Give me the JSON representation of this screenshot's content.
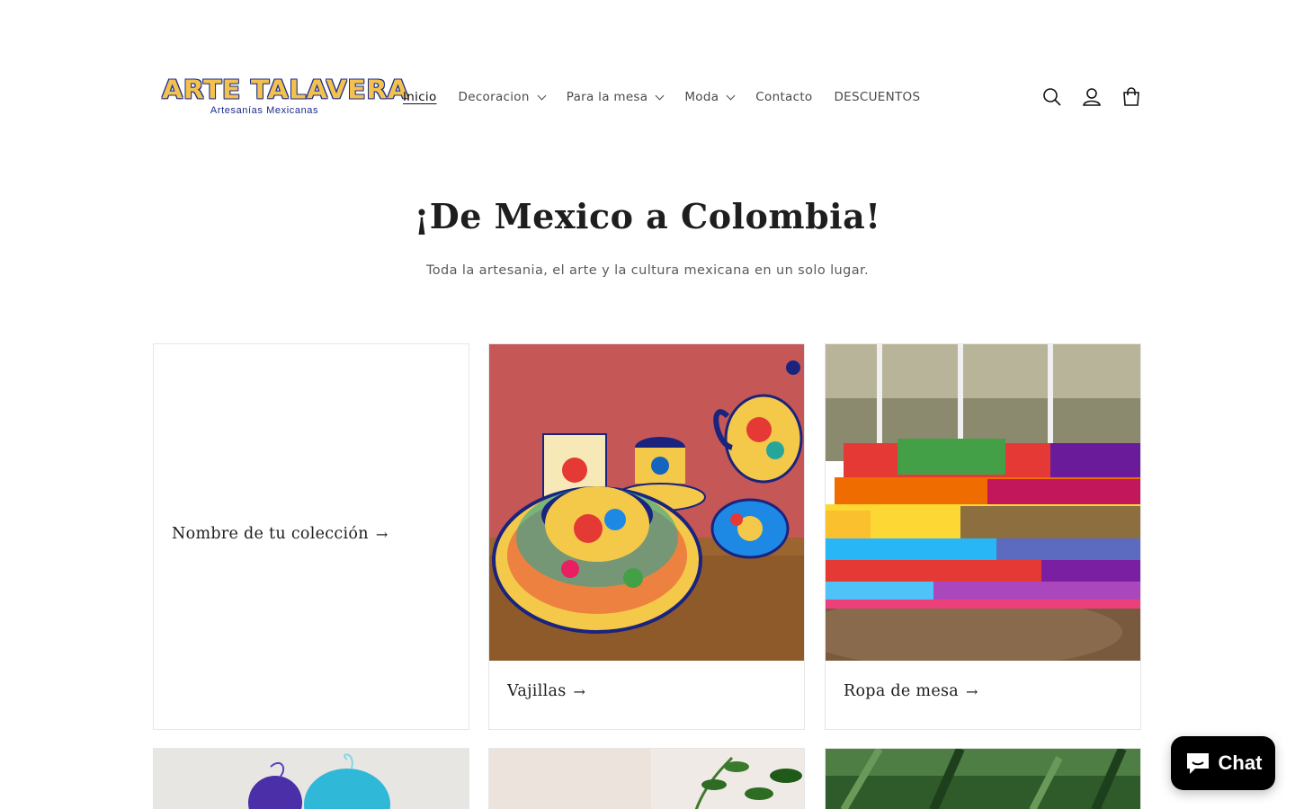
{
  "brand": {
    "logo_text": "ARTE TALAVERA",
    "logo_subtitle": "Artesanías Mexicanas",
    "colors": {
      "logo_fill": "#f2c14e",
      "logo_outline": "#1b2b8c"
    }
  },
  "nav": {
    "items": [
      {
        "label": "Inicio",
        "active": true,
        "has_dropdown": false
      },
      {
        "label": "Decoracion",
        "active": false,
        "has_dropdown": true
      },
      {
        "label": "Para la mesa",
        "active": false,
        "has_dropdown": true
      },
      {
        "label": "Moda",
        "active": false,
        "has_dropdown": true
      },
      {
        "label": "Contacto",
        "active": false,
        "has_dropdown": false
      },
      {
        "label": "DESCUENTOS",
        "active": false,
        "has_dropdown": false
      }
    ]
  },
  "header_icons": [
    "search-icon",
    "account-icon",
    "cart-icon"
  ],
  "hero": {
    "title": "¡De Mexico a Colombia!",
    "subtitle": "Toda la artesania, el arte y la cultura mexicana en un solo lugar."
  },
  "collections": [
    {
      "title": "Nombre de tu colección",
      "arrow": "→",
      "has_image": false
    },
    {
      "title": "Vajillas",
      "arrow": "→",
      "has_image": true
    },
    {
      "title": "Ropa de mesa",
      "arrow": "→",
      "has_image": true
    }
  ],
  "chat": {
    "label": "Chat",
    "icon": "chat-bubble-icon"
  }
}
